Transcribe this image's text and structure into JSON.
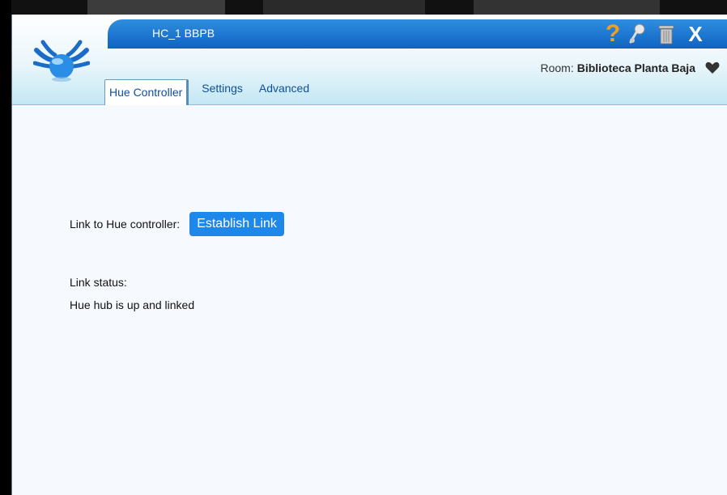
{
  "window": {
    "title": "HC_1 BBPB"
  },
  "toolbar": {
    "icons": [
      "help-icon",
      "pin-icon",
      "trash-icon",
      "close-icon"
    ],
    "help_glyph": "?",
    "close_glyph": "X"
  },
  "room": {
    "label": "Room:",
    "value": "Biblioteca Planta Baja"
  },
  "tabs": [
    {
      "label": "Hue Controller",
      "active": true
    },
    {
      "label": "Settings",
      "active": false
    },
    {
      "label": "Advanced",
      "active": false
    }
  ],
  "main": {
    "link_label": "Link to Hue controller:",
    "establish_button": "Establish Link",
    "status_label": "Link status:",
    "status_value": "Hue hub is up and linked"
  },
  "colors": {
    "titlebar": "#1472d0",
    "accent_button": "#1e87ea",
    "tab_text": "#0f4f99",
    "help_icon": "#f0a020"
  }
}
